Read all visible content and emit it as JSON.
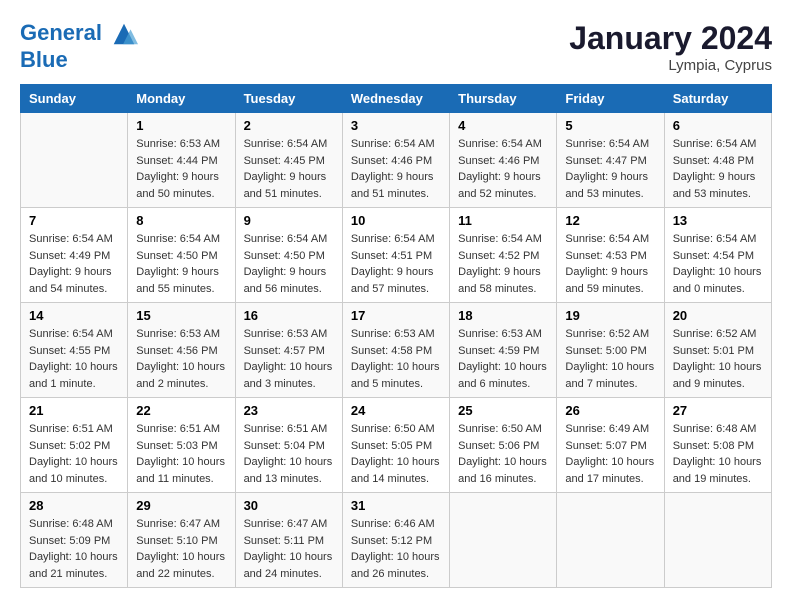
{
  "header": {
    "logo_line1": "General",
    "logo_line2": "Blue",
    "month_year": "January 2024",
    "location": "Lympia, Cyprus"
  },
  "weekdays": [
    "Sunday",
    "Monday",
    "Tuesday",
    "Wednesday",
    "Thursday",
    "Friday",
    "Saturday"
  ],
  "weeks": [
    [
      {
        "day": "",
        "sunrise": "",
        "sunset": "",
        "daylight": ""
      },
      {
        "day": "1",
        "sunrise": "Sunrise: 6:53 AM",
        "sunset": "Sunset: 4:44 PM",
        "daylight": "Daylight: 9 hours and 50 minutes."
      },
      {
        "day": "2",
        "sunrise": "Sunrise: 6:54 AM",
        "sunset": "Sunset: 4:45 PM",
        "daylight": "Daylight: 9 hours and 51 minutes."
      },
      {
        "day": "3",
        "sunrise": "Sunrise: 6:54 AM",
        "sunset": "Sunset: 4:46 PM",
        "daylight": "Daylight: 9 hours and 51 minutes."
      },
      {
        "day": "4",
        "sunrise": "Sunrise: 6:54 AM",
        "sunset": "Sunset: 4:46 PM",
        "daylight": "Daylight: 9 hours and 52 minutes."
      },
      {
        "day": "5",
        "sunrise": "Sunrise: 6:54 AM",
        "sunset": "Sunset: 4:47 PM",
        "daylight": "Daylight: 9 hours and 53 minutes."
      },
      {
        "day": "6",
        "sunrise": "Sunrise: 6:54 AM",
        "sunset": "Sunset: 4:48 PM",
        "daylight": "Daylight: 9 hours and 53 minutes."
      }
    ],
    [
      {
        "day": "7",
        "sunrise": "Sunrise: 6:54 AM",
        "sunset": "Sunset: 4:49 PM",
        "daylight": "Daylight: 9 hours and 54 minutes."
      },
      {
        "day": "8",
        "sunrise": "Sunrise: 6:54 AM",
        "sunset": "Sunset: 4:50 PM",
        "daylight": "Daylight: 9 hours and 55 minutes."
      },
      {
        "day": "9",
        "sunrise": "Sunrise: 6:54 AM",
        "sunset": "Sunset: 4:50 PM",
        "daylight": "Daylight: 9 hours and 56 minutes."
      },
      {
        "day": "10",
        "sunrise": "Sunrise: 6:54 AM",
        "sunset": "Sunset: 4:51 PM",
        "daylight": "Daylight: 9 hours and 57 minutes."
      },
      {
        "day": "11",
        "sunrise": "Sunrise: 6:54 AM",
        "sunset": "Sunset: 4:52 PM",
        "daylight": "Daylight: 9 hours and 58 minutes."
      },
      {
        "day": "12",
        "sunrise": "Sunrise: 6:54 AM",
        "sunset": "Sunset: 4:53 PM",
        "daylight": "Daylight: 9 hours and 59 minutes."
      },
      {
        "day": "13",
        "sunrise": "Sunrise: 6:54 AM",
        "sunset": "Sunset: 4:54 PM",
        "daylight": "Daylight: 10 hours and 0 minutes."
      }
    ],
    [
      {
        "day": "14",
        "sunrise": "Sunrise: 6:54 AM",
        "sunset": "Sunset: 4:55 PM",
        "daylight": "Daylight: 10 hours and 1 minute."
      },
      {
        "day": "15",
        "sunrise": "Sunrise: 6:53 AM",
        "sunset": "Sunset: 4:56 PM",
        "daylight": "Daylight: 10 hours and 2 minutes."
      },
      {
        "day": "16",
        "sunrise": "Sunrise: 6:53 AM",
        "sunset": "Sunset: 4:57 PM",
        "daylight": "Daylight: 10 hours and 3 minutes."
      },
      {
        "day": "17",
        "sunrise": "Sunrise: 6:53 AM",
        "sunset": "Sunset: 4:58 PM",
        "daylight": "Daylight: 10 hours and 5 minutes."
      },
      {
        "day": "18",
        "sunrise": "Sunrise: 6:53 AM",
        "sunset": "Sunset: 4:59 PM",
        "daylight": "Daylight: 10 hours and 6 minutes."
      },
      {
        "day": "19",
        "sunrise": "Sunrise: 6:52 AM",
        "sunset": "Sunset: 5:00 PM",
        "daylight": "Daylight: 10 hours and 7 minutes."
      },
      {
        "day": "20",
        "sunrise": "Sunrise: 6:52 AM",
        "sunset": "Sunset: 5:01 PM",
        "daylight": "Daylight: 10 hours and 9 minutes."
      }
    ],
    [
      {
        "day": "21",
        "sunrise": "Sunrise: 6:51 AM",
        "sunset": "Sunset: 5:02 PM",
        "daylight": "Daylight: 10 hours and 10 minutes."
      },
      {
        "day": "22",
        "sunrise": "Sunrise: 6:51 AM",
        "sunset": "Sunset: 5:03 PM",
        "daylight": "Daylight: 10 hours and 11 minutes."
      },
      {
        "day": "23",
        "sunrise": "Sunrise: 6:51 AM",
        "sunset": "Sunset: 5:04 PM",
        "daylight": "Daylight: 10 hours and 13 minutes."
      },
      {
        "day": "24",
        "sunrise": "Sunrise: 6:50 AM",
        "sunset": "Sunset: 5:05 PM",
        "daylight": "Daylight: 10 hours and 14 minutes."
      },
      {
        "day": "25",
        "sunrise": "Sunrise: 6:50 AM",
        "sunset": "Sunset: 5:06 PM",
        "daylight": "Daylight: 10 hours and 16 minutes."
      },
      {
        "day": "26",
        "sunrise": "Sunrise: 6:49 AM",
        "sunset": "Sunset: 5:07 PM",
        "daylight": "Daylight: 10 hours and 17 minutes."
      },
      {
        "day": "27",
        "sunrise": "Sunrise: 6:48 AM",
        "sunset": "Sunset: 5:08 PM",
        "daylight": "Daylight: 10 hours and 19 minutes."
      }
    ],
    [
      {
        "day": "28",
        "sunrise": "Sunrise: 6:48 AM",
        "sunset": "Sunset: 5:09 PM",
        "daylight": "Daylight: 10 hours and 21 minutes."
      },
      {
        "day": "29",
        "sunrise": "Sunrise: 6:47 AM",
        "sunset": "Sunset: 5:10 PM",
        "daylight": "Daylight: 10 hours and 22 minutes."
      },
      {
        "day": "30",
        "sunrise": "Sunrise: 6:47 AM",
        "sunset": "Sunset: 5:11 PM",
        "daylight": "Daylight: 10 hours and 24 minutes."
      },
      {
        "day": "31",
        "sunrise": "Sunrise: 6:46 AM",
        "sunset": "Sunset: 5:12 PM",
        "daylight": "Daylight: 10 hours and 26 minutes."
      },
      {
        "day": "",
        "sunrise": "",
        "sunset": "",
        "daylight": ""
      },
      {
        "day": "",
        "sunrise": "",
        "sunset": "",
        "daylight": ""
      },
      {
        "day": "",
        "sunrise": "",
        "sunset": "",
        "daylight": ""
      }
    ]
  ]
}
